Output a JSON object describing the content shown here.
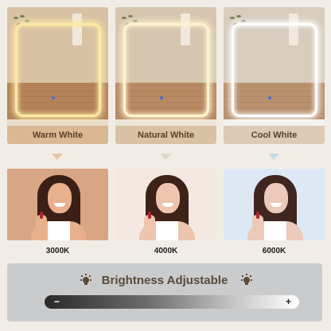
{
  "panels": [
    {
      "label": "Warm White",
      "wall": "#d8c2a3",
      "floor": "#b58358",
      "vanity": "#e7ddcc",
      "glow": "#fde8a5",
      "bar": "#d9b893",
      "text": "#5a3f28"
    },
    {
      "label": "Natural White",
      "wall": "#d7c6af",
      "floor": "#b88962",
      "vanity": "#ece5d9",
      "glow": "#fff3cf",
      "bar": "#d9c1a3",
      "text": "#5a3f28"
    },
    {
      "label": "Cool White",
      "wall": "#d8ccbd",
      "floor": "#b9916f",
      "vanity": "#f4f2ee",
      "glow": "#ffffff",
      "bar": "#dccab6",
      "text": "#5a3f28"
    }
  ],
  "arrows": [
    "#e9c7a3",
    "#e0d7cc",
    "#c7d9e5"
  ],
  "portraits": [
    {
      "bg": "#d8a684",
      "face": "#e8b08c",
      "hair": "#3a1f16",
      "top": "#ffffff"
    },
    {
      "bg": "#f3e9e2",
      "face": "#edc4ad",
      "hair": "#3d2219",
      "top": "#ffffff"
    },
    {
      "bg": "#dce8f4",
      "face": "#ecc9bb",
      "hair": "#3f2620",
      "top": "#ffffff"
    }
  ],
  "temperatures": [
    "3000K",
    "4000K",
    "6000K"
  ],
  "brightness": {
    "title": "Brightness Adjustable",
    "minus": "−",
    "plus": "+",
    "icon": "bulb-icon"
  }
}
